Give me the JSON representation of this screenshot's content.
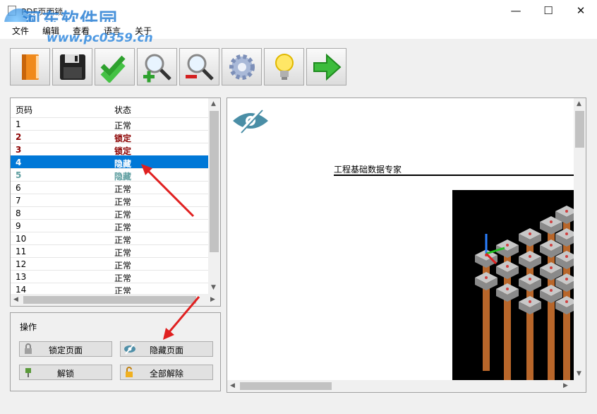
{
  "window": {
    "title": "PDF页面锁",
    "watermark_title": "河东软件园",
    "watermark_url": "www.pc0359.cn",
    "controls": [
      "—",
      "☐",
      "✕"
    ]
  },
  "menu": [
    "文件",
    "编辑",
    "查看",
    "语言",
    "关于"
  ],
  "toolbar": [
    {
      "name": "open-button",
      "icon": "book-icon"
    },
    {
      "name": "save-button",
      "icon": "floppy-disk-icon"
    },
    {
      "name": "check-button",
      "icon": "double-check-icon"
    },
    {
      "name": "zoom-in-button",
      "icon": "zoom-in-icon"
    },
    {
      "name": "zoom-out-button",
      "icon": "zoom-out-icon"
    },
    {
      "name": "settings-button",
      "icon": "gear-icon"
    },
    {
      "name": "tip-button",
      "icon": "lightbulb-icon"
    },
    {
      "name": "next-button",
      "icon": "arrow-right-icon"
    }
  ],
  "page_list": {
    "headers": {
      "page": "页码",
      "status": "状态"
    },
    "rows": [
      {
        "page": "1",
        "status": "正常",
        "type": "normal"
      },
      {
        "page": "2",
        "status": "锁定",
        "type": "locked"
      },
      {
        "page": "3",
        "status": "锁定",
        "type": "locked"
      },
      {
        "page": "4",
        "status": "隐藏",
        "type": "selected"
      },
      {
        "page": "5",
        "status": "隐藏",
        "type": "hidden"
      },
      {
        "page": "6",
        "status": "正常",
        "type": "normal"
      },
      {
        "page": "7",
        "status": "正常",
        "type": "normal"
      },
      {
        "page": "8",
        "status": "正常",
        "type": "normal"
      },
      {
        "page": "9",
        "status": "正常",
        "type": "normal"
      },
      {
        "page": "10",
        "status": "正常",
        "type": "normal"
      },
      {
        "page": "11",
        "status": "正常",
        "type": "normal"
      },
      {
        "page": "12",
        "status": "正常",
        "type": "normal"
      },
      {
        "page": "13",
        "status": "正常",
        "type": "normal"
      },
      {
        "page": "14",
        "status": "正常",
        "type": "normal"
      }
    ]
  },
  "operations": {
    "title": "操作",
    "lock_page": "锁定页面",
    "hide_page": "隐藏页面",
    "unlock": "解锁",
    "release_all": "全部解除"
  },
  "preview": {
    "heading": "工程基础数据专家"
  },
  "colors": {
    "accent": "#0078d7",
    "locked": "#8b0000",
    "hidden": "#5f9ea0",
    "annotation": "#e02020"
  }
}
